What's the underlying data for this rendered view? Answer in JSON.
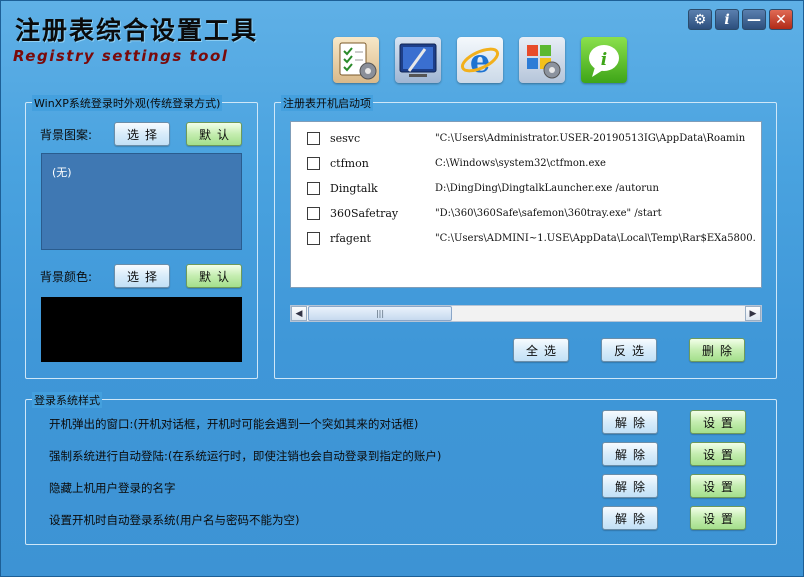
{
  "app": {
    "title_cn": "注册表综合设置工具",
    "title_en": "Registry settings tool"
  },
  "toolbar": {
    "icons": [
      "checklist-gear-icon",
      "display-settings-icon",
      "internet-explorer-icon",
      "windows-gear-icon",
      "info-icon"
    ]
  },
  "window_controls": {
    "settings": "⚙",
    "info": "i",
    "minimize": "—",
    "close": "✕"
  },
  "appearance": {
    "group_title": "WinXP系统登录时外观(传统登录方式)",
    "bg_image_label": "背景图案:",
    "bg_image_value": "(无)",
    "bg_color_label": "背景颜色:",
    "select_label": "选择",
    "default_label": "默认",
    "bg_color_value": "#000000"
  },
  "startup": {
    "group_title": "注册表开机启动项",
    "items": [
      {
        "name": "sesvc",
        "command": "\"C:\\Users\\Administrator.USER-20190513IG\\AppData\\Roamin"
      },
      {
        "name": "ctfmon",
        "command": "C:\\Windows\\system32\\ctfmon.exe"
      },
      {
        "name": "Dingtalk",
        "command": "D:\\DingDing\\DingtalkLauncher.exe /autorun"
      },
      {
        "name": "360Safetray",
        "command": "\"D:\\360\\360Safe\\safemon\\360tray.exe\" /start"
      },
      {
        "name": "rfagent",
        "command": "\"C:\\Users\\ADMINI~1.USE\\AppData\\Local\\Temp\\Rar$EXa5800."
      }
    ],
    "select_all": "全选",
    "invert": "反选",
    "delete": "删除"
  },
  "login": {
    "group_title": "登录系统样式",
    "items": [
      {
        "text": "开机弹出的窗口:(开机对话框，开机时可能会遇到一个突如其来的对话框)"
      },
      {
        "text": "强制系统进行自动登陆:(在系统运行时，即使注销也会自动登录到指定的账户)"
      },
      {
        "text": "隐藏上机用户登录的名字"
      },
      {
        "text": "设置开机时自动登录系统(用户名与密码不能为空)"
      }
    ],
    "remove_label": "解除",
    "set_label": "设置"
  }
}
